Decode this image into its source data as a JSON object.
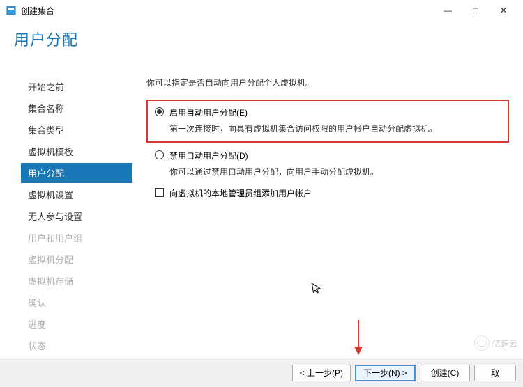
{
  "window": {
    "title": "创建集合",
    "minimize": "—",
    "maximize": "□",
    "close": "✕"
  },
  "page": {
    "heading": "用户分配"
  },
  "sidebar": {
    "items": [
      {
        "label": "开始之前",
        "state": "normal"
      },
      {
        "label": "集合名称",
        "state": "normal"
      },
      {
        "label": "集合类型",
        "state": "normal"
      },
      {
        "label": "虚拟机模板",
        "state": "normal"
      },
      {
        "label": "用户分配",
        "state": "active"
      },
      {
        "label": "虚拟机设置",
        "state": "normal"
      },
      {
        "label": "无人参与设置",
        "state": "normal"
      },
      {
        "label": "用户和用户组",
        "state": "disabled"
      },
      {
        "label": "虚拟机分配",
        "state": "disabled"
      },
      {
        "label": "虚拟机存储",
        "state": "disabled"
      },
      {
        "label": "确认",
        "state": "disabled"
      },
      {
        "label": "进度",
        "state": "disabled"
      },
      {
        "label": "状态",
        "state": "disabled"
      }
    ]
  },
  "main": {
    "instruction": "你可以指定是否自动向用户分配个人虚拟机。",
    "option_enable": {
      "label": "启用自动用户分配(E)",
      "desc": "第一次连接时，向具有虚拟机集合访问权限的用户帐户自动分配虚拟机。",
      "selected": true
    },
    "option_disable": {
      "label": "禁用自动用户分配(D)",
      "desc": "你可以通过禁用自动用户分配，向用户手动分配虚拟机。",
      "selected": false
    },
    "checkbox_admin": {
      "label": "向虚拟机的本地管理员组添加用户帐户",
      "checked": false
    }
  },
  "footer": {
    "prev": "< 上一步(P)",
    "next": "下一步(N) >",
    "create": "创建(C)",
    "cancel": "取"
  },
  "watermark": {
    "text": "亿速云"
  }
}
